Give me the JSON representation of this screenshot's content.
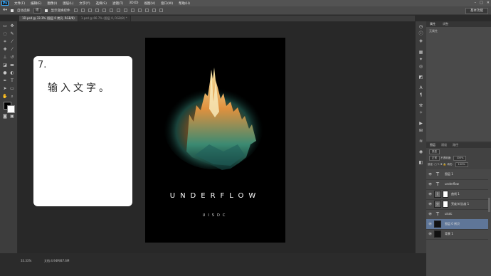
{
  "app": {
    "logo": "Ps"
  },
  "menu": [
    "文件(F)",
    "编辑(E)",
    "图像(I)",
    "图层(L)",
    "文字(Y)",
    "选择(S)",
    "滤镜(T)",
    "3D(D)",
    "视图(V)",
    "窗口(W)",
    "帮助(H)"
  ],
  "window_controls": [
    "–",
    "□",
    "✕"
  ],
  "options": {
    "auto_select": "自动选择",
    "auto_select_target": "组",
    "show_transform": "显示变换控件",
    "workspace": "基本功能"
  },
  "tabs": [
    "1D.psd @ 33.3% (图层 0 拷贝, RGB/8)",
    "1.psd @ 66.7% (图层 0, RGB/8) *"
  ],
  "poster": {
    "title": "UNDERFLOW",
    "subtitle": "UISDC"
  },
  "step_card": {
    "number": "7.",
    "text": "输入文字。"
  },
  "status": {
    "zoom": "33.33%",
    "doc": "文档:4.94M/87.6M"
  },
  "panels": {
    "properties_tab": "属性",
    "adjust_tab": "调整",
    "properties_note": "无属性",
    "layers_tab": "图层",
    "channels_tab": "通道",
    "paths_tab": "路径",
    "filter_kind": "类型",
    "blend_mode": "正常",
    "opacity_label": "不透明度:",
    "opacity_value": "100%",
    "lock_label": "锁定:",
    "fill_label": "填充:",
    "fill_value": "100%"
  },
  "layers": [
    {
      "name": "图层 1",
      "kind": "text"
    },
    {
      "name": "underflow",
      "kind": "text"
    },
    {
      "name": "曲线 1",
      "kind": "adjust"
    },
    {
      "name": "亮度/对比度 1",
      "kind": "adjust"
    },
    {
      "name": "uisdc",
      "kind": "text"
    },
    {
      "name": "图层 0 拷贝",
      "kind": "image",
      "selected": true
    },
    {
      "name": "背景 1",
      "kind": "dark"
    }
  ],
  "colors": {
    "accent": "#31a8ff",
    "selected_layer": "#5f7698",
    "poster_bg": "#000000",
    "panel_bg": "#424242"
  }
}
